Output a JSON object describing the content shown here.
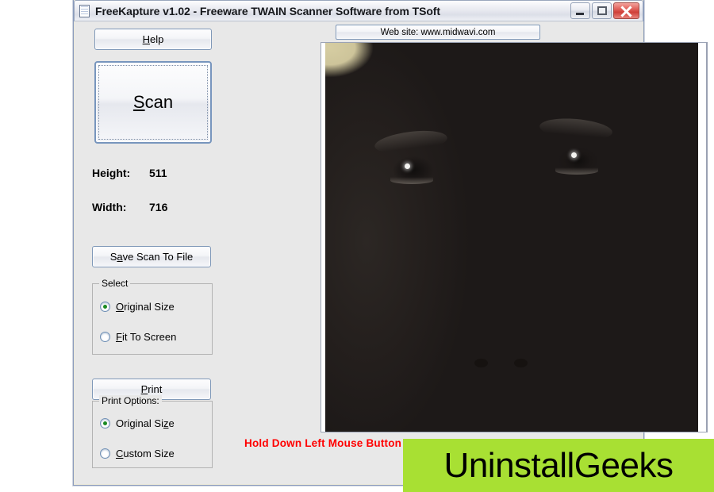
{
  "window": {
    "title": "FreeKapture v1.02 - Freeware TWAIN Scanner Software from TSoft",
    "icon": "document-icon",
    "buttons": {
      "minimize": "minimize-button",
      "maximize": "maximize-button",
      "close": "close-button"
    }
  },
  "left_panel": {
    "help_label_pre": "H",
    "help_label_post": "elp",
    "scan_label_pre": "S",
    "scan_label_post": "can",
    "height_label": "Height:",
    "height_value": "511",
    "width_label": "Width:",
    "width_value": "716",
    "save_label_pre": "S",
    "save_label_mid": "a",
    "save_label_post": "ve Scan To File",
    "print_label_pre": "P",
    "print_label_post": "rint",
    "select_group": {
      "title": "Select",
      "options": [
        {
          "pre": "O",
          "post": "riginal Size",
          "checked": true
        },
        {
          "pre": "F",
          "post": "it To Screen",
          "checked": false
        }
      ]
    },
    "print_options_group": {
      "title": "Print Options:",
      "options": [
        {
          "pre": "Original Si",
          "mid": "z",
          "post": "e",
          "checked": true
        },
        {
          "pre": "C",
          "post": "ustom Size",
          "checked": false
        }
      ]
    }
  },
  "image_panel": {
    "website_button_label": "Web site: www.midwavi.com",
    "scroll_hint": "Hold Down Left Mouse Button To Scroll",
    "photo_alt": "scanned photograph of a black labrador dog face"
  },
  "watermark": {
    "text": "UninstallGeeks",
    "background_color": "#a8e033",
    "text_color": "#000000"
  },
  "colors": {
    "window_face": "#e8e8e8",
    "title_bar": "#eef0f5",
    "button_border": "#7f98b8",
    "radio_dot": "#1a8a22",
    "status_text": "#ff0000",
    "close_button": "#cf3f38"
  }
}
